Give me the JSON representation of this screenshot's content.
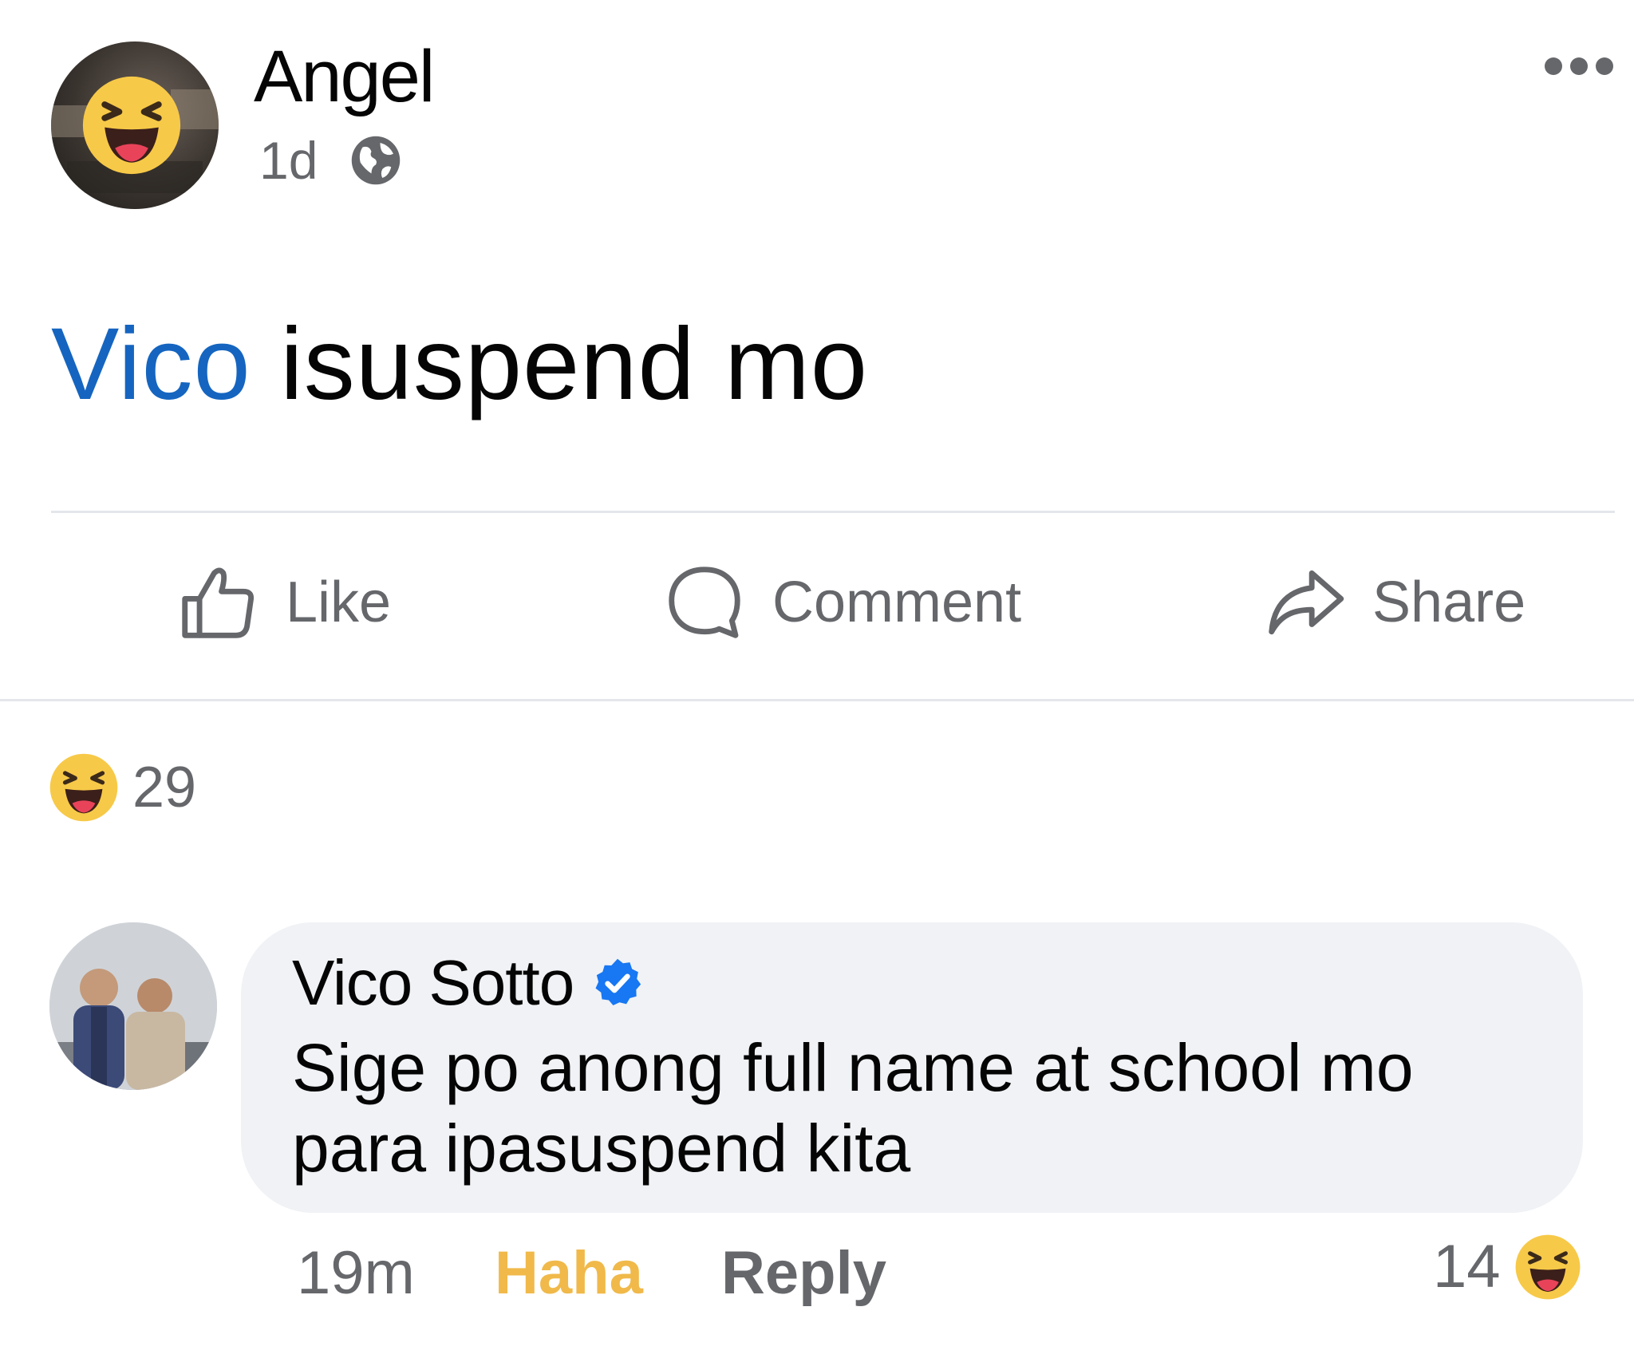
{
  "post": {
    "author": "Angel",
    "time": "1d",
    "audience_icon": "globe-icon",
    "mention": "Vico",
    "text": " isuspend mo",
    "more_icon": "more-options-icon"
  },
  "actions": {
    "like": "Like",
    "comment": "Comment",
    "share": "Share"
  },
  "reactions": {
    "icon": "haha-reaction-icon",
    "count": "29"
  },
  "comment": {
    "author": "Vico Sotto",
    "verified": true,
    "text": "Sige po anong full name at school mo para ipasuspend kita",
    "time": "19m",
    "reaction_label": "Haha",
    "reply_label": "Reply",
    "reaction_count": "14"
  },
  "colors": {
    "mention_blue": "#1565c0",
    "haha_yellow": "#f0b94a",
    "verified_blue": "#1877f2",
    "secondary_text": "#65676b",
    "bubble_bg": "#f0f2f5"
  }
}
